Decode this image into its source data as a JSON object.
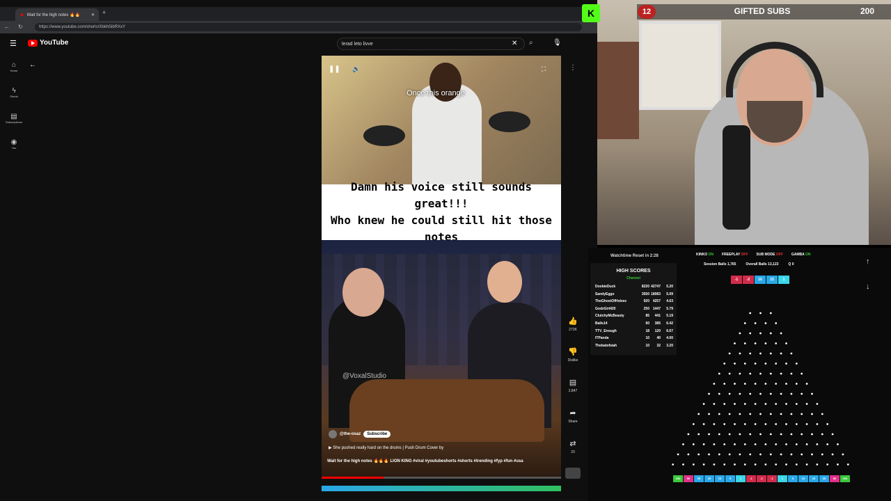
{
  "browser": {
    "tab_title": "Wait for the high notes 🔥🔥",
    "new_tab_icon": "plus-icon",
    "url": "https://www.youtube.com/shorts/XbkhSibRXxY"
  },
  "youtube": {
    "logo_text": "YouTube",
    "search_value": "lerad leto livve",
    "sidebar": [
      {
        "label": "Home",
        "icon": "home-icon"
      },
      {
        "label": "Shorts",
        "icon": "shorts-icon"
      },
      {
        "label": "Subscriptions",
        "icon": "subscriptions-icon"
      },
      {
        "label": "You",
        "icon": "you-icon"
      }
    ],
    "short": {
      "top_caption": "Once this orange",
      "text_line1": "Damn his voice still sounds great!!!",
      "text_line2": "Who knew he could still hit those notes",
      "watermark": "@VoxalStudio",
      "channel": "@the-osaz",
      "subscribe_label": "Subscribe",
      "sound": "She pushed really hard on the drums | Push Drum Cover by",
      "title": "Wait for the high notes 🔥🔥🔥 LION KING #viral #youtubeshorts #shorts #trending #fyp #fun #usa",
      "progress": 0.26
    },
    "actions": {
      "likes": "272K",
      "dislike": "Dislike",
      "comments": "2,847",
      "share": "Share",
      "remix": "23"
    }
  },
  "stream": {
    "badge_count": "12",
    "gifted_label": "GIFTED SUBS",
    "gifted_count": "200",
    "kick_logo": "K",
    "watchtime": "Watchtime Reset in 2:28",
    "high_scores_title": "HIGH SCORES",
    "high_scores_sub": "Channel",
    "high_scores": [
      {
        "name": "DoobieDuck",
        "a": "8220",
        "b": "42747",
        "c": "5.20"
      },
      {
        "name": "SandyEggo",
        "a": "3550",
        "b": "18083",
        "c": "5.09"
      },
      {
        "name": "TheGhostOfHoleec",
        "a": "920",
        "b": "4257",
        "c": "4.63"
      },
      {
        "name": "GodzGirl420",
        "a": "250",
        "b": "1447",
        "c": "5.79"
      },
      {
        "name": "ClutchyMcBeasty",
        "a": "85",
        "b": "441",
        "c": "5.19"
      },
      {
        "name": "Balls14",
        "a": "60",
        "b": "385",
        "c": "6.42"
      },
      {
        "name": "TTV_Enough",
        "a": "18",
        "b": "120",
        "c": "6.67"
      },
      {
        "name": "ITPanda",
        "a": "10",
        "b": "40",
        "c": "4.00"
      },
      {
        "name": "Thebatofsiah",
        "a": "10",
        "b": "32",
        "c": "3.20"
      }
    ],
    "modes": [
      {
        "label": "KINKO",
        "state": "ON"
      },
      {
        "label": "FREEPLAY",
        "state": "OFF"
      },
      {
        "label": "SUB MODE",
        "state": "OFF"
      },
      {
        "label": "GAMBA",
        "state": "ON"
      }
    ],
    "session_label": "Session Balls",
    "session_value": "1,765",
    "overall_label": "Overall Balls",
    "overall_value": "13,123",
    "q_label": "Q",
    "q_value": "0",
    "chips": [
      {
        "v": "-1",
        "color": "#d22c4c"
      },
      {
        "v": "-2",
        "color": "#d22c4c"
      },
      {
        "v": "10",
        "color": "#2aa8e8"
      },
      {
        "v": "10",
        "color": "#2aa8e8"
      },
      {
        "v": "1",
        "color": "#3bd6e8"
      }
    ],
    "buckets": [
      {
        "v": "100",
        "color": "#3cc83c"
      },
      {
        "v": "50",
        "color": "#e0308a"
      },
      {
        "v": "35",
        "color": "#2aa8e8"
      },
      {
        "v": "20",
        "color": "#2aa8e8"
      },
      {
        "v": "10",
        "color": "#2aa8e8"
      },
      {
        "v": "5",
        "color": "#2aa8e8"
      },
      {
        "v": "1",
        "color": "#3bd6e8"
      },
      {
        "v": "-1",
        "color": "#d22c4c"
      },
      {
        "v": "-2",
        "color": "#d22c4c"
      },
      {
        "v": "-1",
        "color": "#d22c4c"
      },
      {
        "v": "1",
        "color": "#3bd6e8"
      },
      {
        "v": "5",
        "color": "#2aa8e8"
      },
      {
        "v": "10",
        "color": "#2aa8e8"
      },
      {
        "v": "20",
        "color": "#2aa8e8"
      },
      {
        "v": "35",
        "color": "#2aa8e8"
      },
      {
        "v": "50",
        "color": "#e0308a"
      },
      {
        "v": "100",
        "color": "#3cc83c"
      }
    ]
  }
}
